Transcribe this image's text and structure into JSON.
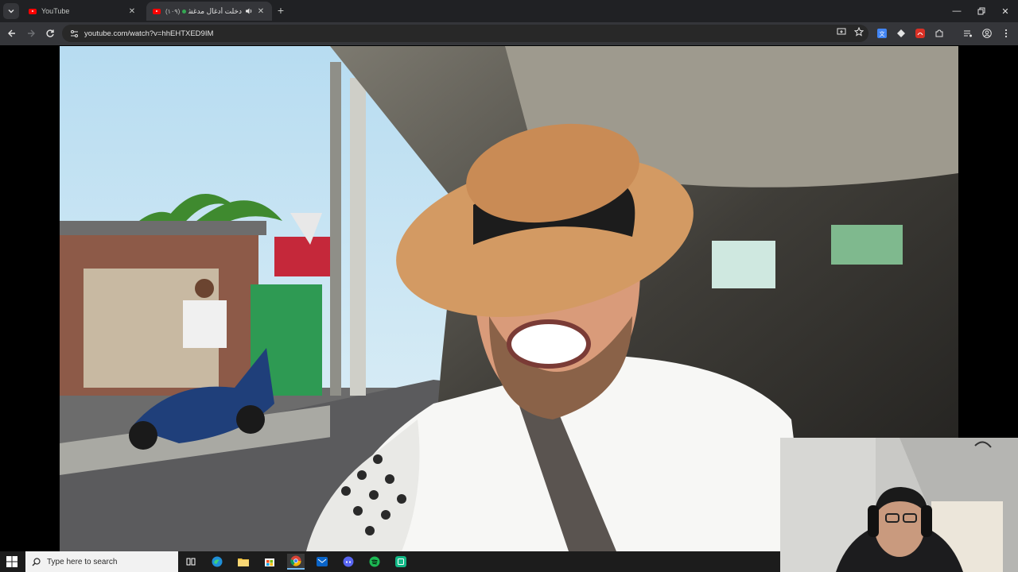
{
  "browser": {
    "tabs": [
      {
        "title": "YouTube",
        "active": false
      },
      {
        "title": "دخلت أدغال مدغشقر",
        "prefix": "(١٠٩)",
        "active": true,
        "playing_audio": true
      }
    ],
    "new_tab_label": "+",
    "url": "youtube.com/watch?v=hhEHTXED9IM"
  },
  "taskbar": {
    "search_placeholder": "Type here to search",
    "apps": [
      "task-view",
      "edge",
      "file-explorer",
      "store",
      "chrome",
      "outlook",
      "discord",
      "spotify",
      "clipchamp"
    ]
  },
  "colors": {
    "youtube_red": "#ff0000",
    "tab_strip": "#202124",
    "toolbar": "#35363a",
    "taskbar": "#1c1c1c"
  }
}
